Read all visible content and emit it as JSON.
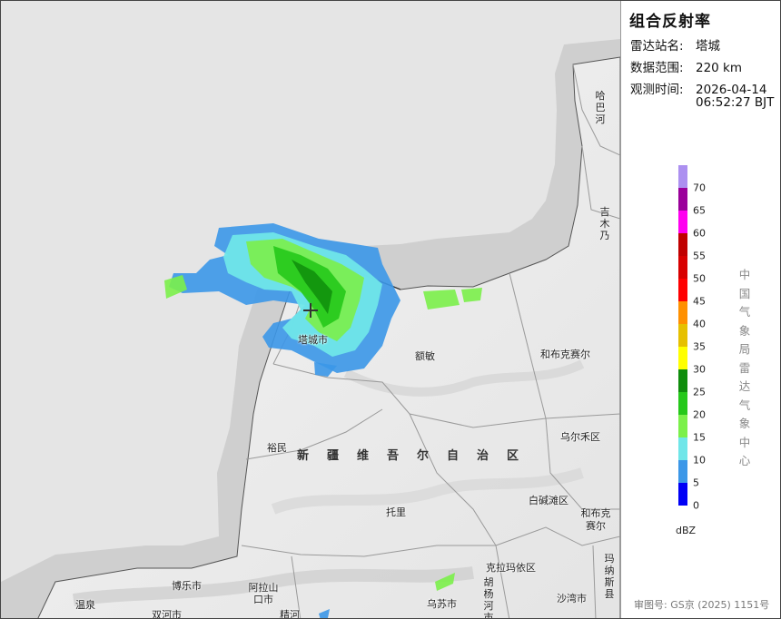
{
  "panel": {
    "title": "组合反射率",
    "station_label": "雷达站名:",
    "station_value": "塔城",
    "range_label": "数据范围:",
    "range_value": "220 km",
    "time_label": "观测时间:",
    "time_date": "2026-04-14",
    "time_clock": "06:52:27 BJT",
    "unit": "dBZ",
    "agency_vertical": [
      "中",
      "国",
      "气",
      "象",
      "局",
      "雷",
      "达",
      "气",
      "象",
      "中",
      "心"
    ],
    "review_no": "审图号: GS京 (2025) 1151号"
  },
  "legend": {
    "colors": [
      "#0000f6",
      "#3b97e8",
      "#6fe6e9",
      "#7bf04a",
      "#25c81a",
      "#0f8d0c",
      "#ffff00",
      "#e6c000",
      "#ff9000",
      "#ff0000",
      "#d80000",
      "#c00000",
      "#ff00f0",
      "#9a009a",
      "#ac90f0"
    ],
    "labels": [
      "0",
      "5",
      "10",
      "15",
      "20",
      "25",
      "30",
      "35",
      "40",
      "45",
      "50",
      "55",
      "60",
      "65",
      "70"
    ]
  },
  "map": {
    "region_name": "新疆维吾尔自治区",
    "places": [
      {
        "name": "塔城市"
      },
      {
        "name": "额敏"
      },
      {
        "name": "和布克赛尔"
      },
      {
        "name": "裕民"
      },
      {
        "name": "乌尔禾区"
      },
      {
        "name": "托里"
      },
      {
        "name": "白碱滩区"
      },
      {
        "name": "克拉玛依区"
      },
      {
        "name": "博乐市"
      },
      {
        "name": "温泉"
      },
      {
        "name": "双河市"
      },
      {
        "name": "精河"
      },
      {
        "name": "乌苏市"
      },
      {
        "name": "沙湾市"
      }
    ],
    "vertical_places": [
      {
        "name": "哈巴河"
      },
      {
        "name": "吉木乃"
      },
      {
        "name": "阿拉山口市"
      },
      {
        "name": "和布克赛尔"
      },
      {
        "name": "胡杨河市"
      },
      {
        "name": "玛纳斯县"
      }
    ]
  }
}
